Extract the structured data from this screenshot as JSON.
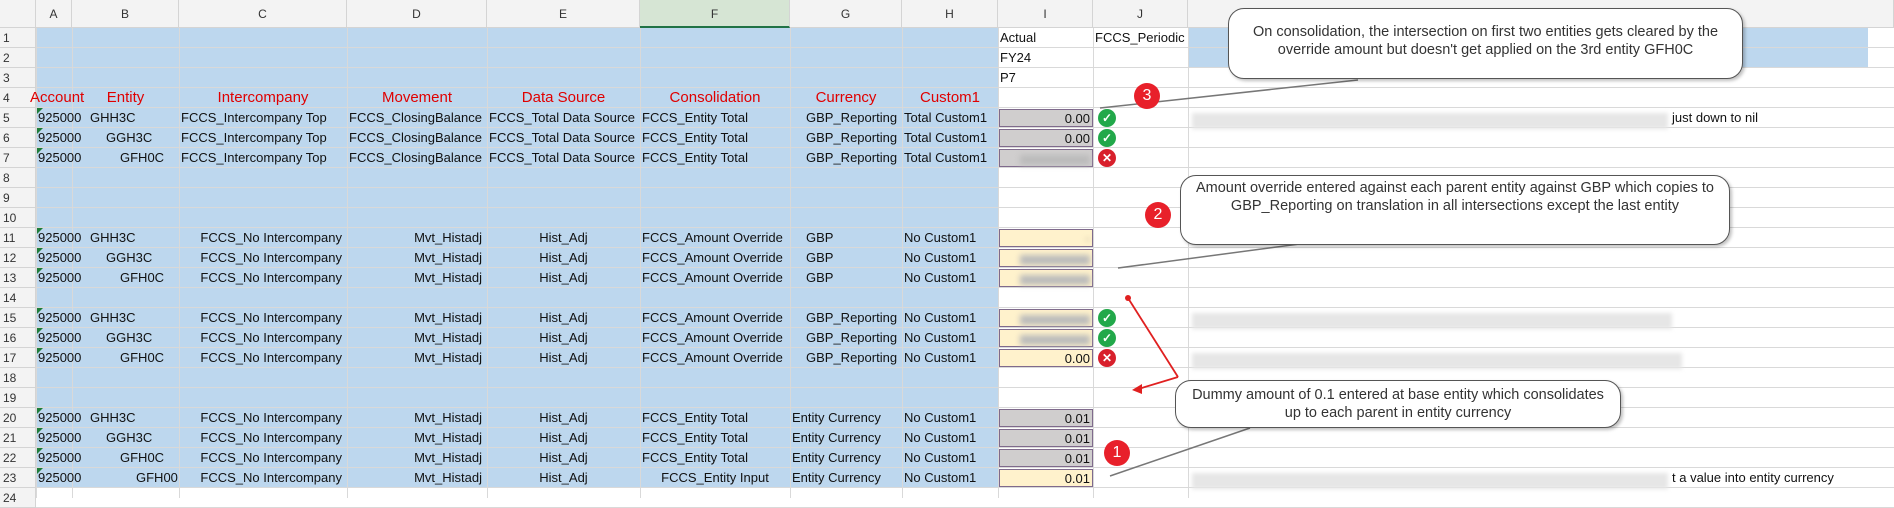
{
  "columns": [
    "A",
    "B",
    "C",
    "D",
    "E",
    "F",
    "G",
    "H",
    "I",
    "J"
  ],
  "row_numbers": [
    "1",
    "2",
    "3",
    "4",
    "5",
    "6",
    "7",
    "8",
    "9",
    "10",
    "11",
    "12",
    "13",
    "14",
    "15",
    "16",
    "17",
    "18",
    "19",
    "20",
    "21",
    "22",
    "23",
    "24"
  ],
  "top_meta": {
    "actual": "Actual",
    "fy": "FY24",
    "period": "P7",
    "view": "FCCS_Periodic"
  },
  "headers": [
    "Account",
    "Entity",
    "Intercompany",
    "Movement",
    "Data Source",
    "Consolidation",
    "Currency",
    "Custom1"
  ],
  "rows": [
    {
      "row": "5",
      "account": "925000",
      "entity": "GHH3C",
      "ico": "FCCS_Intercompany Top",
      "mvmt": "FCCS_ClosingBalance",
      "src": "FCCS_Total Data Source",
      "cons": "FCCS_Entity Total",
      "cur": "GBP_Reporting",
      "c1": "Total Custom1",
      "val": "0.00",
      "style": "gray",
      "mark": "ok"
    },
    {
      "row": "6",
      "account": "925000",
      "entity": "GGH3C",
      "ico": "FCCS_Intercompany Top",
      "mvmt": "FCCS_ClosingBalance",
      "src": "FCCS_Total Data Source",
      "cons": "FCCS_Entity Total",
      "cur": "GBP_Reporting",
      "c1": "Total Custom1",
      "val": "0.00",
      "style": "gray",
      "mark": "ok"
    },
    {
      "row": "7",
      "account": "925000",
      "entity": "GFH0C",
      "ico": "FCCS_Intercompany Top",
      "mvmt": "FCCS_ClosingBalance",
      "src": "FCCS_Total Data Source",
      "cons": "FCCS_Entity Total",
      "cur": "GBP_Reporting",
      "c1": "Total Custom1",
      "val": "",
      "style": "gray blurred",
      "mark": "bad"
    },
    {
      "row": "11",
      "account": "925000",
      "entity": "GHH3C",
      "ico": "FCCS_No Intercompany",
      "mvmt": "Mvt_Histadj",
      "src": "Hist_Adj",
      "cons": "FCCS_Amount Override",
      "cur": "GBP",
      "c1": "No Custom1",
      "val": "-",
      "style": "yellow blurred",
      "mark": ""
    },
    {
      "row": "12",
      "account": "925000",
      "entity": "GGH3C",
      "ico": "FCCS_No Intercompany",
      "mvmt": "Mvt_Histadj",
      "src": "Hist_Adj",
      "cons": "FCCS_Amount Override",
      "cur": "GBP",
      "c1": "No Custom1",
      "val": "",
      "style": "yellow blurred",
      "mark": ""
    },
    {
      "row": "13",
      "account": "925000",
      "entity": "GFH0C",
      "ico": "FCCS_No Intercompany",
      "mvmt": "Mvt_Histadj",
      "src": "Hist_Adj",
      "cons": "FCCS_Amount Override",
      "cur": "GBP",
      "c1": "No Custom1",
      "val": "",
      "style": "yellow blurred",
      "mark": ""
    },
    {
      "row": "15",
      "account": "925000",
      "entity": "GHH3C",
      "ico": "FCCS_No Intercompany",
      "mvmt": "Mvt_Histadj",
      "src": "Hist_Adj",
      "cons": "FCCS_Amount Override",
      "cur": "GBP_Reporting",
      "c1": "No Custom1",
      "val": "",
      "style": "yellow blurred",
      "mark": "ok"
    },
    {
      "row": "16",
      "account": "925000",
      "entity": "GGH3C",
      "ico": "FCCS_No Intercompany",
      "mvmt": "Mvt_Histadj",
      "src": "Hist_Adj",
      "cons": "FCCS_Amount Override",
      "cur": "GBP_Reporting",
      "c1": "No Custom1",
      "val": "",
      "style": "yellow blurred",
      "mark": "ok"
    },
    {
      "row": "17",
      "account": "925000",
      "entity": "GFH0C",
      "ico": "FCCS_No Intercompany",
      "mvmt": "Mvt_Histadj",
      "src": "Hist_Adj",
      "cons": "FCCS_Amount Override",
      "cur": "GBP_Reporting",
      "c1": "No Custom1",
      "val": "0.00",
      "style": "yellow",
      "mark": "bad"
    },
    {
      "row": "20",
      "account": "925000",
      "entity": "GHH3C",
      "ico": "FCCS_No Intercompany",
      "mvmt": "Mvt_Histadj",
      "src": "Hist_Adj",
      "cons": "FCCS_Entity Total",
      "cur": "Entity Currency",
      "c1": "No Custom1",
      "val": "0.01",
      "style": "gray",
      "mark": ""
    },
    {
      "row": "21",
      "account": "925000",
      "entity": "GGH3C",
      "ico": "FCCS_No Intercompany",
      "mvmt": "Mvt_Histadj",
      "src": "Hist_Adj",
      "cons": "FCCS_Entity Total",
      "cur": "Entity Currency",
      "c1": "No Custom1",
      "val": "0.01",
      "style": "gray",
      "mark": ""
    },
    {
      "row": "22",
      "account": "925000",
      "entity": "GFH0C",
      "ico": "FCCS_No Intercompany",
      "mvmt": "Mvt_Histadj",
      "src": "Hist_Adj",
      "cons": "FCCS_Entity Total",
      "cur": "Entity Currency",
      "c1": "No Custom1",
      "val": "0.01",
      "style": "gray",
      "mark": ""
    },
    {
      "row": "23",
      "account": "925000",
      "entity": "GFH00",
      "ico": "FCCS_No Intercompany",
      "mvmt": "Mvt_Histadj",
      "src": "Hist_Adj",
      "cons": "FCCS_Entity Input",
      "cur": "Entity Currency",
      "c1": "No Custom1",
      "val": "0.01",
      "style": "yellow",
      "mark": ""
    }
  ],
  "callouts": {
    "c3": "On consolidation, the intersection on first two entities gets cleared by the override amount but doesn't get applied on the 3rd entity GFH0C",
    "c2": "Amount override entered against each parent entity against GBP which copies to GBP_Reporting on translation in all intersections except the last entity",
    "c1": "Dummy amount of 0.1 entered at base entity which consolidates up to each parent in entity currency"
  },
  "badges": {
    "b1": "1",
    "b2": "2",
    "b3": "3"
  },
  "notes": {
    "row5_tail": "just down to nil",
    "row23_tail": "t a value into entity currency"
  },
  "marks": {
    "ok": "✓",
    "bad": "✕"
  }
}
